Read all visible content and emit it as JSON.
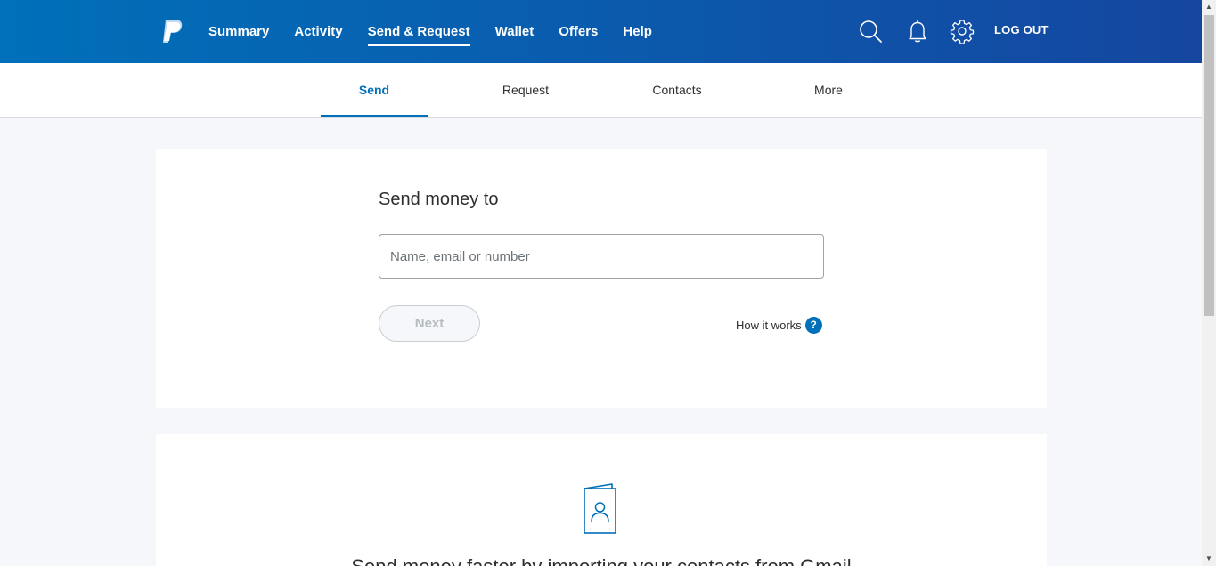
{
  "header": {
    "logo_icon": "paypal-logo",
    "nav": [
      {
        "label": "Summary"
      },
      {
        "label": "Activity"
      },
      {
        "label": "Send & Request"
      },
      {
        "label": "Wallet"
      },
      {
        "label": "Offers"
      },
      {
        "label": "Help"
      }
    ],
    "active_nav": "Send & Request",
    "icons": [
      "search-icon",
      "bell-icon",
      "gear-icon"
    ],
    "logout_label": "LOG OUT",
    "gradient_start": "#0070ba",
    "gradient_end": "#1546a0"
  },
  "subnav": {
    "tabs": [
      {
        "label": "Send"
      },
      {
        "label": "Request"
      },
      {
        "label": "Contacts"
      },
      {
        "label": "More"
      }
    ],
    "active_tab": "Send",
    "accent": "#0070ba"
  },
  "send_card": {
    "title": "Send money to",
    "recipient_placeholder": "Name, email or number",
    "recipient_value": "",
    "next_label": "Next",
    "how_it_works_label": "How it works",
    "help_glyph": "?"
  },
  "import_card": {
    "icon": "contacts-book-icon",
    "text": "Send money faster by importing your contacts from Gmail"
  }
}
